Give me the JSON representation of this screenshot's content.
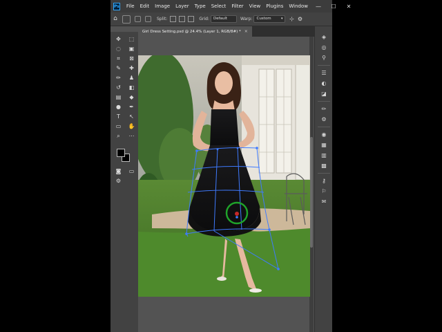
{
  "app": {
    "logo": "Ps"
  },
  "menu": [
    "File",
    "Edit",
    "Image",
    "Layer",
    "Type",
    "Select",
    "Filter",
    "View",
    "Plugins",
    "Window"
  ],
  "window_controls": [
    "—",
    "☐",
    "✕"
  ],
  "options_bar": {
    "split_label": "Split:",
    "grid_label": "Grid:",
    "grid_value": "Default",
    "warp_label": "Warp:",
    "warp_value": "Custom"
  },
  "document": {
    "tab_title": "Girl Dress Setting.psd @ 24.4% (Layer 1, RGB/8#) *",
    "tab_close": "×"
  },
  "tools": [
    {
      "name": "move-tool",
      "icon": "✥"
    },
    {
      "name": "marquee-tool",
      "icon": "⬚"
    },
    {
      "name": "lasso-tool",
      "icon": "◌"
    },
    {
      "name": "object-select-tool",
      "icon": "▣"
    },
    {
      "name": "crop-tool",
      "icon": "⌗"
    },
    {
      "name": "frame-tool",
      "icon": "⊠"
    },
    {
      "name": "eyedropper-tool",
      "icon": "✎"
    },
    {
      "name": "healing-brush-tool",
      "icon": "✚"
    },
    {
      "name": "brush-tool",
      "icon": "✏"
    },
    {
      "name": "clone-stamp-tool",
      "icon": "♟"
    },
    {
      "name": "history-brush-tool",
      "icon": "↺"
    },
    {
      "name": "eraser-tool",
      "icon": "◧"
    },
    {
      "name": "gradient-tool",
      "icon": "▤"
    },
    {
      "name": "blur-tool",
      "icon": "◆"
    },
    {
      "name": "dodge-tool",
      "icon": "●"
    },
    {
      "name": "pen-tool",
      "icon": "✒"
    },
    {
      "name": "type-tool",
      "icon": "T"
    },
    {
      "name": "path-select-tool",
      "icon": "↖"
    },
    {
      "name": "shape-tool",
      "icon": "▭"
    },
    {
      "name": "hand-tool",
      "icon": "✋"
    },
    {
      "name": "zoom-tool",
      "icon": "⌕"
    },
    {
      "name": "more-tools",
      "icon": "⋯"
    }
  ],
  "right_panel_icons": [
    {
      "name": "layers-icon",
      "icon": "◈"
    },
    {
      "name": "channels-icon",
      "icon": "◎"
    },
    {
      "name": "paths-icon",
      "icon": "⚲"
    },
    {
      "name": "adjustments-icon",
      "icon": "☰"
    },
    {
      "name": "properties-icon",
      "icon": "◐"
    },
    {
      "name": "styles-icon",
      "icon": "◪"
    },
    {
      "name": "brush-settings-icon",
      "icon": "✏"
    },
    {
      "name": "brushes-icon",
      "icon": "⚙"
    },
    {
      "name": "color-icon",
      "icon": "◉"
    },
    {
      "name": "swatches-icon",
      "icon": "▦"
    },
    {
      "name": "gradients-icon",
      "icon": "▥"
    },
    {
      "name": "patterns-icon",
      "icon": "▩"
    },
    {
      "name": "libraries-icon",
      "icon": "⚷"
    },
    {
      "name": "learn-icon",
      "icon": "⚐"
    },
    {
      "name": "comments-icon",
      "icon": "✉"
    }
  ],
  "colors": {
    "menubar_bg": "#3c3c3c",
    "panel_bg": "#424242",
    "canvas_bg": "#535353",
    "warp_grid": "#3f7bff",
    "pin": "#1fa32a"
  }
}
